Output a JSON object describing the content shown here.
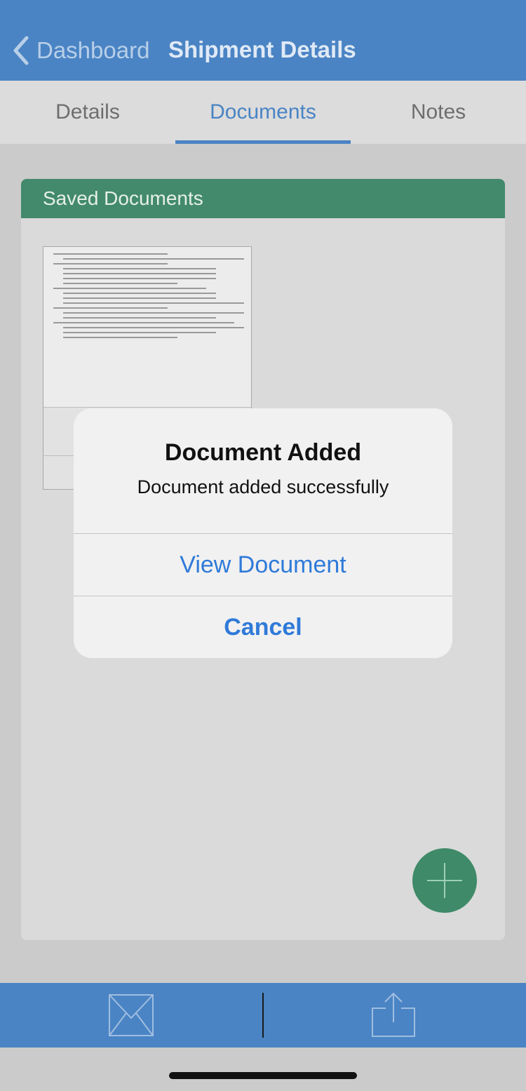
{
  "header": {
    "back_label": "Dashboard",
    "title": "Shipment Details"
  },
  "tabs": [
    {
      "label": "Details",
      "active": false
    },
    {
      "label": "Documents",
      "active": true
    },
    {
      "label": "Notes",
      "active": false
    }
  ],
  "card": {
    "title": "Saved Documents"
  },
  "documents": [
    {
      "icon": "document-thumbnail"
    }
  ],
  "fab": {
    "icon": "plus-icon"
  },
  "toolbar": {
    "mail_icon": "envelope-icon",
    "share_icon": "share-icon"
  },
  "alert": {
    "title": "Document Added",
    "message": "Document added successfully",
    "primary_label": "View Document",
    "cancel_label": "Cancel"
  },
  "colors": {
    "nav": "#4a84c4",
    "card_header": "#428a6b",
    "fab": "#3f8a68",
    "alert_button": "#2f7ad9"
  }
}
